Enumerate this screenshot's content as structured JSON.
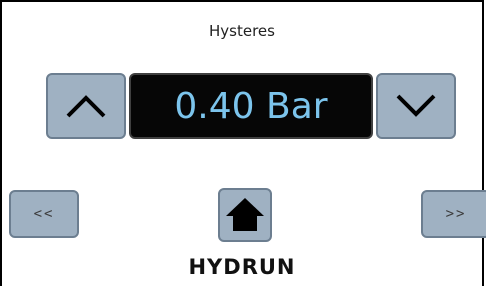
{
  "screen": {
    "title": "Hysteres",
    "value_display": "0.40 Bar",
    "prev_label": "<<",
    "next_label": ">>",
    "logo_text": "HYDRUN"
  },
  "icons": {
    "up": "chevron-up-icon",
    "down": "chevron-down-icon",
    "home": "home-icon"
  },
  "colors": {
    "button_fill": "#9fb1c2",
    "button_border": "#6c7e90",
    "display_background": "#060606",
    "display_text": "#7cc4ec"
  }
}
